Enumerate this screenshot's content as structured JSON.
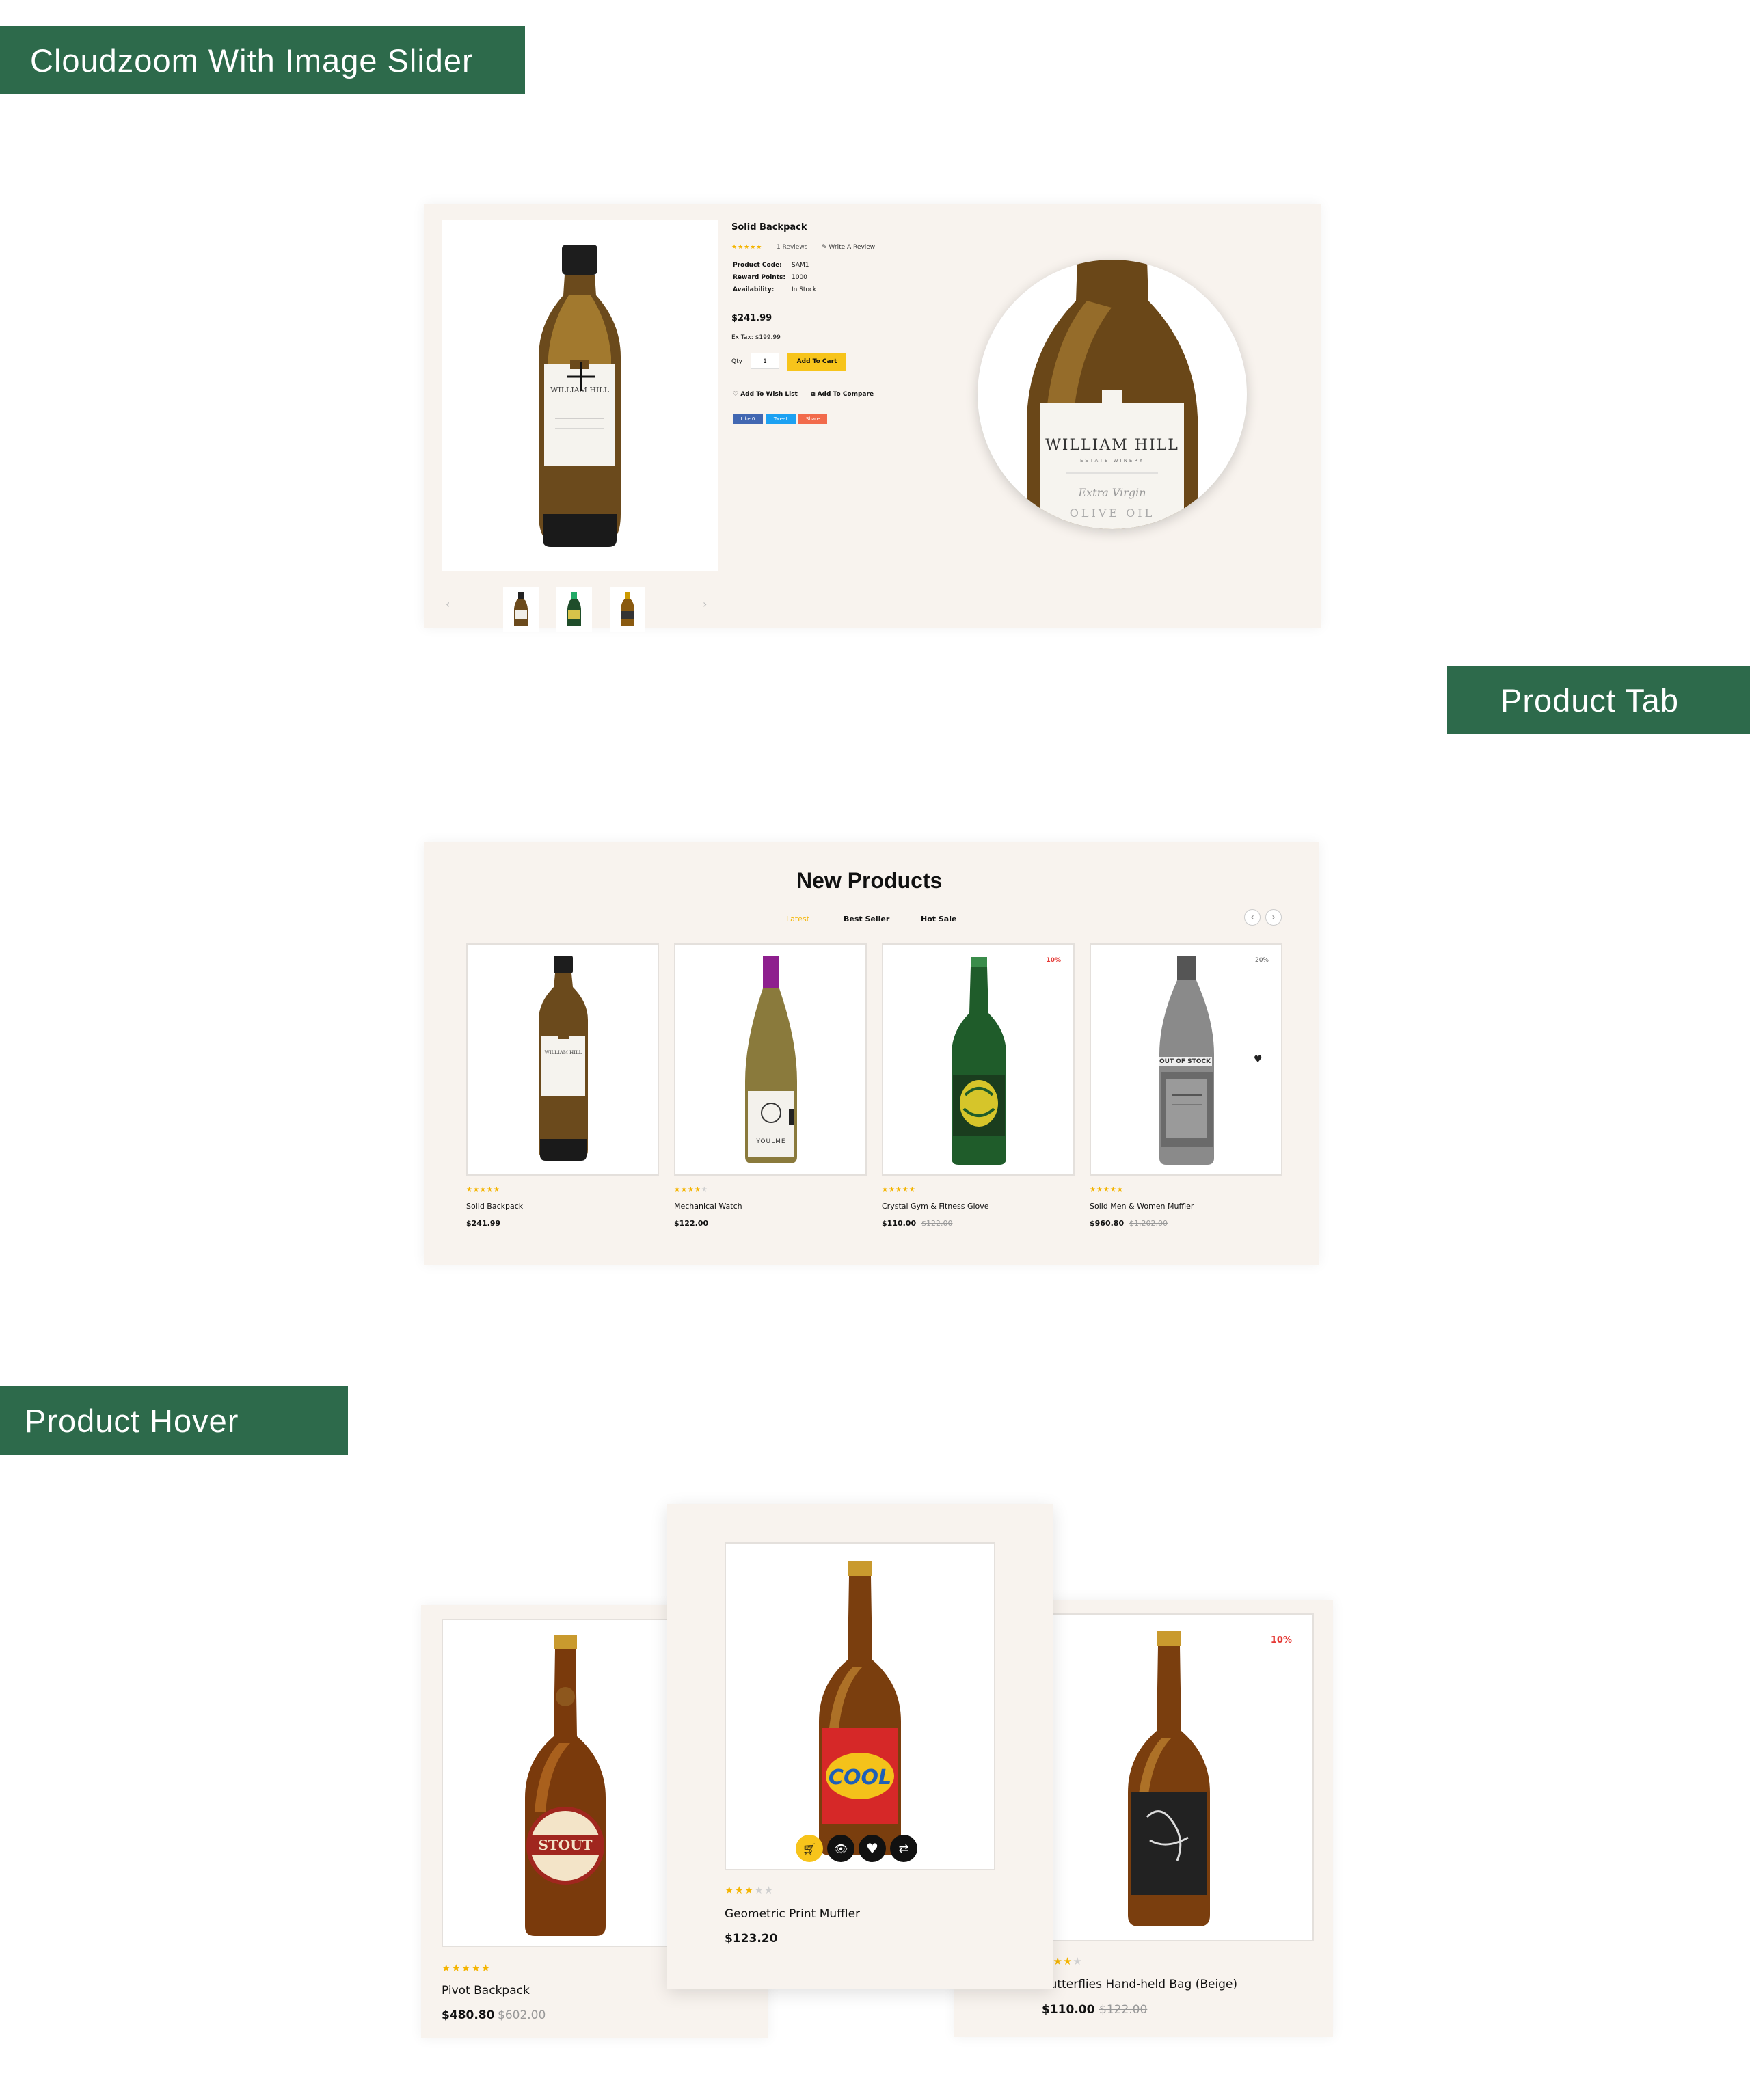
{
  "banners": {
    "cloudzoom": "Cloudzoom With Image Slider",
    "product_tab": "Product Tab",
    "product_hover": "Product Hover"
  },
  "product_detail": {
    "title": "Solid Backpack",
    "rating": 5,
    "reviews_label": "1 Reviews",
    "write_review": "Write A Review",
    "fields": [
      {
        "label": "Product Code:",
        "value": "SAM1"
      },
      {
        "label": "Reward Points:",
        "value": "1000"
      },
      {
        "label": "Availability:",
        "value": "In Stock"
      }
    ],
    "price": "$241.99",
    "ex_tax": "Ex Tax: $199.99",
    "qty_label": "Qty",
    "qty_value": "1",
    "add_to_cart": "Add To Cart",
    "wishlist": "Add To Wish List",
    "compare": "Add To Compare",
    "social": [
      "Like 0",
      "Tweet",
      "Share"
    ],
    "zoom_label_line1": "WILLIAM HILL",
    "zoom_label_line2": "ESTATE WINERY",
    "zoom_label_line3": "Extra Virgin",
    "zoom_label_line4": "OLIVE OIL",
    "bottle_label": "WILLIAM HILL"
  },
  "product_tab": {
    "heading": "New Products",
    "tabs": [
      "Latest",
      "Best Seller",
      "Hot Sale"
    ],
    "active_tab": "Latest",
    "products": [
      {
        "name": "Solid Backpack",
        "price": "$241.99",
        "old_price": "",
        "badge": "",
        "rating": 5,
        "out_of_stock": ""
      },
      {
        "name": "Mechanical Watch",
        "price": "$122.00",
        "old_price": "",
        "badge": "",
        "rating": 4,
        "out_of_stock": ""
      },
      {
        "name": "Crystal Gym & Fitness Glove",
        "price": "$110.00",
        "old_price": "$122.00",
        "badge": "10%",
        "rating": 5,
        "out_of_stock": ""
      },
      {
        "name": "Solid Men & Women Muffler",
        "price": "$960.80",
        "old_price": "$1,202.00",
        "badge": "20%",
        "rating": 5,
        "out_of_stock": "OUT OF STOCK"
      }
    ],
    "bottle2_label": "YOULME"
  },
  "product_hover": {
    "products": [
      {
        "name": "Pivot Backpack",
        "price": "$480.80",
        "old_price": "$602.00",
        "rating": 5,
        "badge": ""
      },
      {
        "name": "Geometric Print Muffler",
        "price": "$123.20",
        "old_price": "",
        "rating": 3,
        "badge": ""
      },
      {
        "name": "Butterflies Hand-held Bag (Beige)",
        "price": "$110.00",
        "old_price": "$122.00",
        "rating": 3,
        "badge": "10%"
      }
    ],
    "label_stout": "STOUT",
    "label_cool": "COOL"
  },
  "colors": {
    "brand_green": "#2d6a4b",
    "accent_yellow": "#f7c41b",
    "panel_bg": "#f8f3ee",
    "sale_red": "#e53935"
  }
}
